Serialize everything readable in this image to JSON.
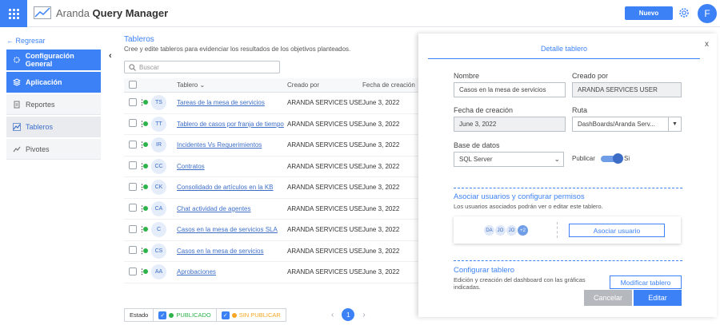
{
  "app": {
    "title_light": "Aranda ",
    "title_bold": "Query Manager"
  },
  "header": {
    "new_label": "Nuevo",
    "avatar_initial": "F"
  },
  "sidebar": {
    "back_label": "Regresar",
    "items": [
      {
        "label": "Configuración General",
        "icon": "gear-icon"
      },
      {
        "label": "Aplicación",
        "icon": "layers-icon"
      },
      {
        "label": "Reportes",
        "icon": "report-icon"
      },
      {
        "label": "Tableros",
        "icon": "dashboard-icon"
      },
      {
        "label": "Pivotes",
        "icon": "pivot-icon"
      }
    ]
  },
  "main": {
    "title": "Tableros",
    "subtitle": "Cree y edite tableros para evidenciar los resultados de los objetivos planteados.",
    "search_placeholder": "Buscar",
    "columns": {
      "name": "Tablero",
      "created_by": "Creado por",
      "created_date": "Fecha de creación"
    },
    "rows": [
      {
        "initials": "TS",
        "name": "Tareas de la mesa de servicios",
        "created_by": "ARANDA SERVICES USER",
        "date": "June 3, 2022"
      },
      {
        "initials": "TT",
        "name": "Tablero de casos por franja de tiempo",
        "created_by": "ARANDA SERVICES USER",
        "date": "June 3, 2022"
      },
      {
        "initials": "IR",
        "name": "Incidentes Vs Requerimientos",
        "created_by": "ARANDA SERVICES USER",
        "date": "June 3, 2022"
      },
      {
        "initials": "CC",
        "name": "Contratos",
        "created_by": "ARANDA SERVICES USER",
        "date": "June 3, 2022"
      },
      {
        "initials": "CK",
        "name": "Consolidado de artículos en la KB",
        "created_by": "ARANDA SERVICES USER",
        "date": "June 3, 2022"
      },
      {
        "initials": "CA",
        "name": "Chat actividad de agentes",
        "created_by": "ARANDA SERVICES USER",
        "date": "June 3, 2022"
      },
      {
        "initials": "C",
        "name": "Casos en la mesa de servicios SLA",
        "created_by": "ARANDA SERVICES USER",
        "date": "June 3, 2022"
      },
      {
        "initials": "CS",
        "name": "Casos en la mesa de servicios",
        "created_by": "ARANDA SERVICES USER",
        "date": "June 3, 2022"
      },
      {
        "initials": "AA",
        "name": "Aprobaciones",
        "created_by": "ARANDA SERVICES USER",
        "date": "June 3, 2022"
      }
    ],
    "status": {
      "label": "Estado",
      "published": "PUBLICADO",
      "unpublished": "SIN PUBLICAR"
    },
    "pager": {
      "current": "1"
    }
  },
  "panel": {
    "title": "Detalle tablero",
    "close": "x",
    "name_label": "Nombre",
    "name_value": "Casos en la mesa de servicios",
    "created_by_label": "Creado por",
    "created_by_value": "ARANDA SERVICES USER",
    "date_label": "Fecha de creación",
    "date_value": "June 3, 2022",
    "route_label": "Ruta",
    "route_value": "DashBoards/Aranda Serv...",
    "db_label": "Base de datos",
    "db_value": "SQL Server",
    "publish_label": "Publicar",
    "publish_state": "Si",
    "assoc_title": "Asociar usuarios y configurar permisos",
    "assoc_sub": "Los usuarios asociados podrán ver o editar este tablero.",
    "users": [
      "DA",
      "JO",
      "JO"
    ],
    "users_more": "+2",
    "assoc_button": "Asociar usuario",
    "config_title": "Configurar tablero",
    "config_sub": "Edición y creación del dashboard con las gráficas indicadas.",
    "modify_button": "Modificar tablero",
    "cancel_button": "Cancelar",
    "edit_button": "Editar"
  },
  "colors": {
    "primary": "#3c82f6",
    "published": "#2eb34b",
    "unpublished": "#f5a623"
  }
}
